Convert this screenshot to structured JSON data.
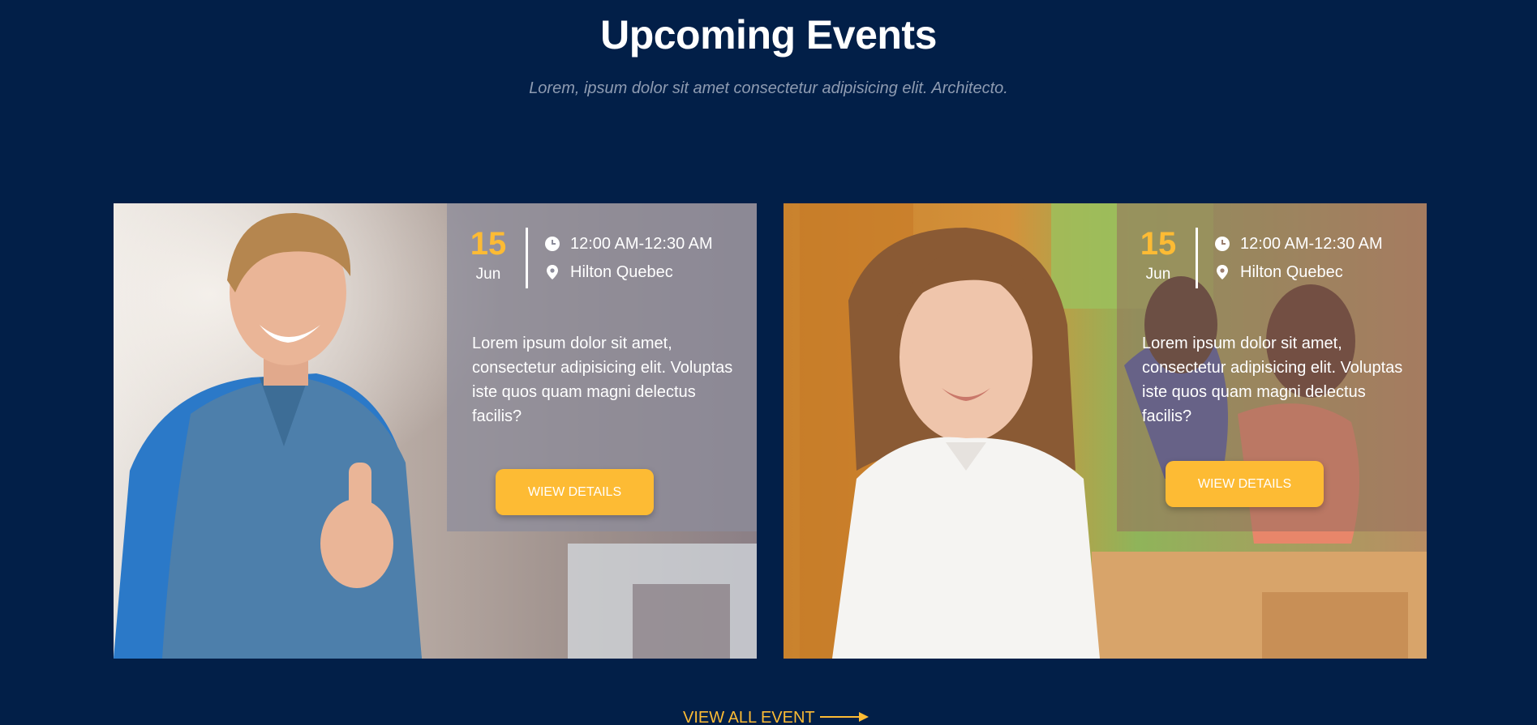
{
  "header": {
    "title": "Upcoming Events",
    "subtitle": "Lorem, ipsum dolor sit amet consectetur adipisicing elit. Architecto."
  },
  "events": [
    {
      "photo_alt": "Student with backpack giving thumbs up",
      "day": "15",
      "month": "Jun",
      "time": "12:00 AM-12:30 AM",
      "location": "Hilton Quebec",
      "description": "Lorem ipsum dolor sit amet, consectetur adipisicing elit. Voluptas iste quos quam magni delectus facilis?",
      "button_label": "WIEW DETAILS"
    },
    {
      "photo_alt": "Smiling student in classroom",
      "day": "15",
      "month": "Jun",
      "time": "12:00 AM-12:30 AM",
      "location": "Hilton Quebec",
      "description": "Lorem ipsum dolor sit amet, consectetur adipisicing elit. Voluptas iste quos quam magni delectus facilis?",
      "button_label": "WIEW DETAILS"
    }
  ],
  "footer_link": {
    "label": "VIEW ALL EVENT"
  },
  "icons": {
    "time": "clock-icon",
    "location": "map-pin-icon",
    "arrow": "arrow-right-icon"
  },
  "colors": {
    "background": "#021f48",
    "accent": "#fdbb34",
    "subtitle": "#8e9bb1"
  }
}
